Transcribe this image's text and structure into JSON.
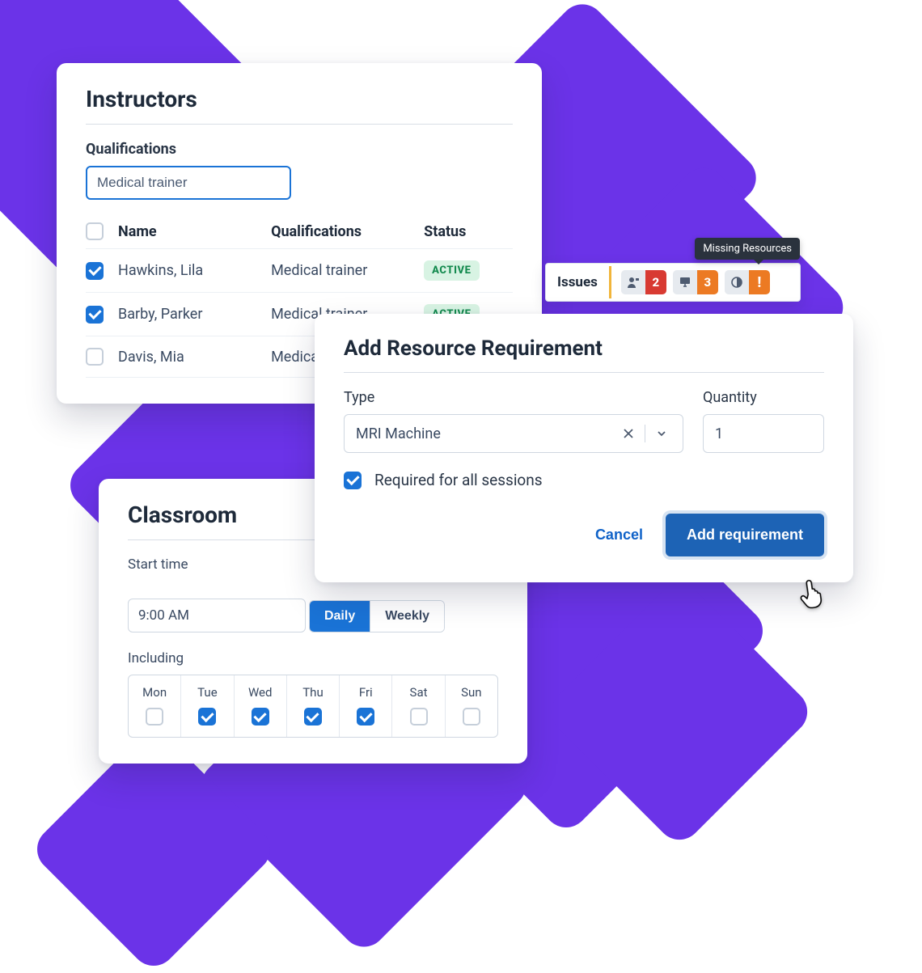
{
  "instructors": {
    "title": "Instructors",
    "filter_label": "Qualifications",
    "filter_value": "Medical trainer",
    "columns": {
      "name": "Name",
      "qualifications": "Qualifications",
      "status": "Status"
    },
    "rows": [
      {
        "checked": true,
        "name": "Hawkins, Lila",
        "qualifications": "Medical trainer",
        "status": "ACTIVE"
      },
      {
        "checked": true,
        "name": "Barby, Parker",
        "qualifications": "Medical trainer",
        "status": "ACTIVE"
      },
      {
        "checked": false,
        "name": "Davis, Mia",
        "qualifications": "Medical",
        "status": ""
      }
    ]
  },
  "classroom": {
    "title": "Classroom",
    "start_label": "Start time",
    "start_value": "9:00 AM",
    "segments": {
      "daily": "Daily",
      "weekly": "Weekly",
      "active": "daily"
    },
    "including_label": "Including",
    "days": [
      {
        "label": "Mon",
        "checked": false
      },
      {
        "label": "Tue",
        "checked": true
      },
      {
        "label": "Wed",
        "checked": true
      },
      {
        "label": "Thu",
        "checked": true
      },
      {
        "label": "Fri",
        "checked": true
      },
      {
        "label": "Sat",
        "checked": false
      },
      {
        "label": "Sun",
        "checked": false
      }
    ]
  },
  "issues": {
    "label": "Issues",
    "tooltip": "Missing Resources",
    "badges": [
      {
        "icon": "person",
        "count": "2",
        "color": "red"
      },
      {
        "icon": "projector",
        "count": "3",
        "color": "orange"
      },
      {
        "icon": "contrast",
        "count": "!",
        "color": "orange"
      }
    ]
  },
  "add_req": {
    "title": "Add Resource Requirement",
    "type_label": "Type",
    "type_value": "MRI Machine",
    "qty_label": "Quantity",
    "qty_value": "1",
    "required_all_label": "Required for all sessions",
    "required_all_checked": true,
    "cancel": "Cancel",
    "submit": "Add requirement"
  }
}
